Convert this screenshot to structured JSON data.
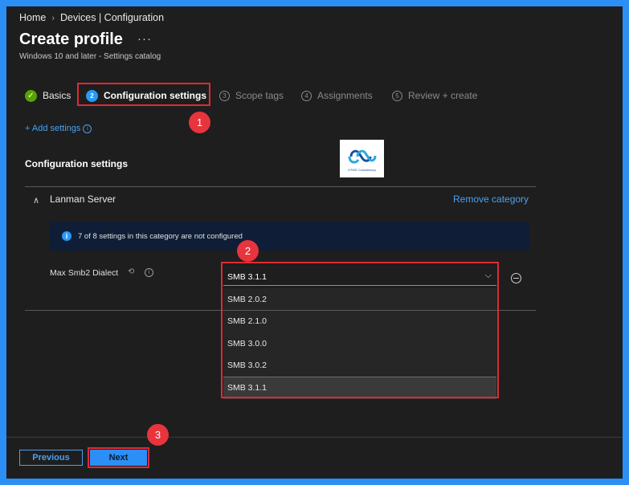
{
  "breadcrumb": {
    "home": "Home",
    "separator": "›",
    "current": "Devices | Configuration"
  },
  "page": {
    "title": "Create profile",
    "more": "···",
    "subtitle": "Windows 10 and later - Settings catalog"
  },
  "steps": [
    {
      "num": "✓",
      "label": "Basics",
      "state": "done"
    },
    {
      "num": "2",
      "label": "Configuration settings",
      "state": "active"
    },
    {
      "num": "3",
      "label": "Scope tags",
      "state": "pending"
    },
    {
      "num": "4",
      "label": "Assignments",
      "state": "pending"
    },
    {
      "num": "5",
      "label": "Review + create",
      "state": "pending"
    }
  ],
  "badges": {
    "one": "1",
    "two": "2",
    "three": "3"
  },
  "add_settings": {
    "label": "+ Add settings",
    "info": "i"
  },
  "section": {
    "title": "Configuration settings"
  },
  "logo": {
    "text": "HTMD Consultancy"
  },
  "category": {
    "chevron": "∧",
    "name": "Lanman Server",
    "remove": "Remove category"
  },
  "info_bar": {
    "icon": "i",
    "text": "7 of 8 settings in this category are not configured"
  },
  "setting": {
    "label": "Max Smb2 Dialect",
    "sync_icon": "⟲",
    "info": "i",
    "value": "SMB 3.1.1",
    "chevron": "⌵"
  },
  "dropdown_options": [
    "SMB 2.0.2",
    "SMB 2.1.0",
    "SMB 3.0.0",
    "SMB 3.0.2",
    "SMB 3.1.1"
  ],
  "dropdown_selected": "SMB 3.1.1",
  "buttons": {
    "previous": "Previous",
    "next": "Next"
  },
  "colors": {
    "accent": "#2b8ff5",
    "annotation_red": "#e02a35",
    "success_green": "#57a300",
    "background": "#1e1e1e"
  }
}
